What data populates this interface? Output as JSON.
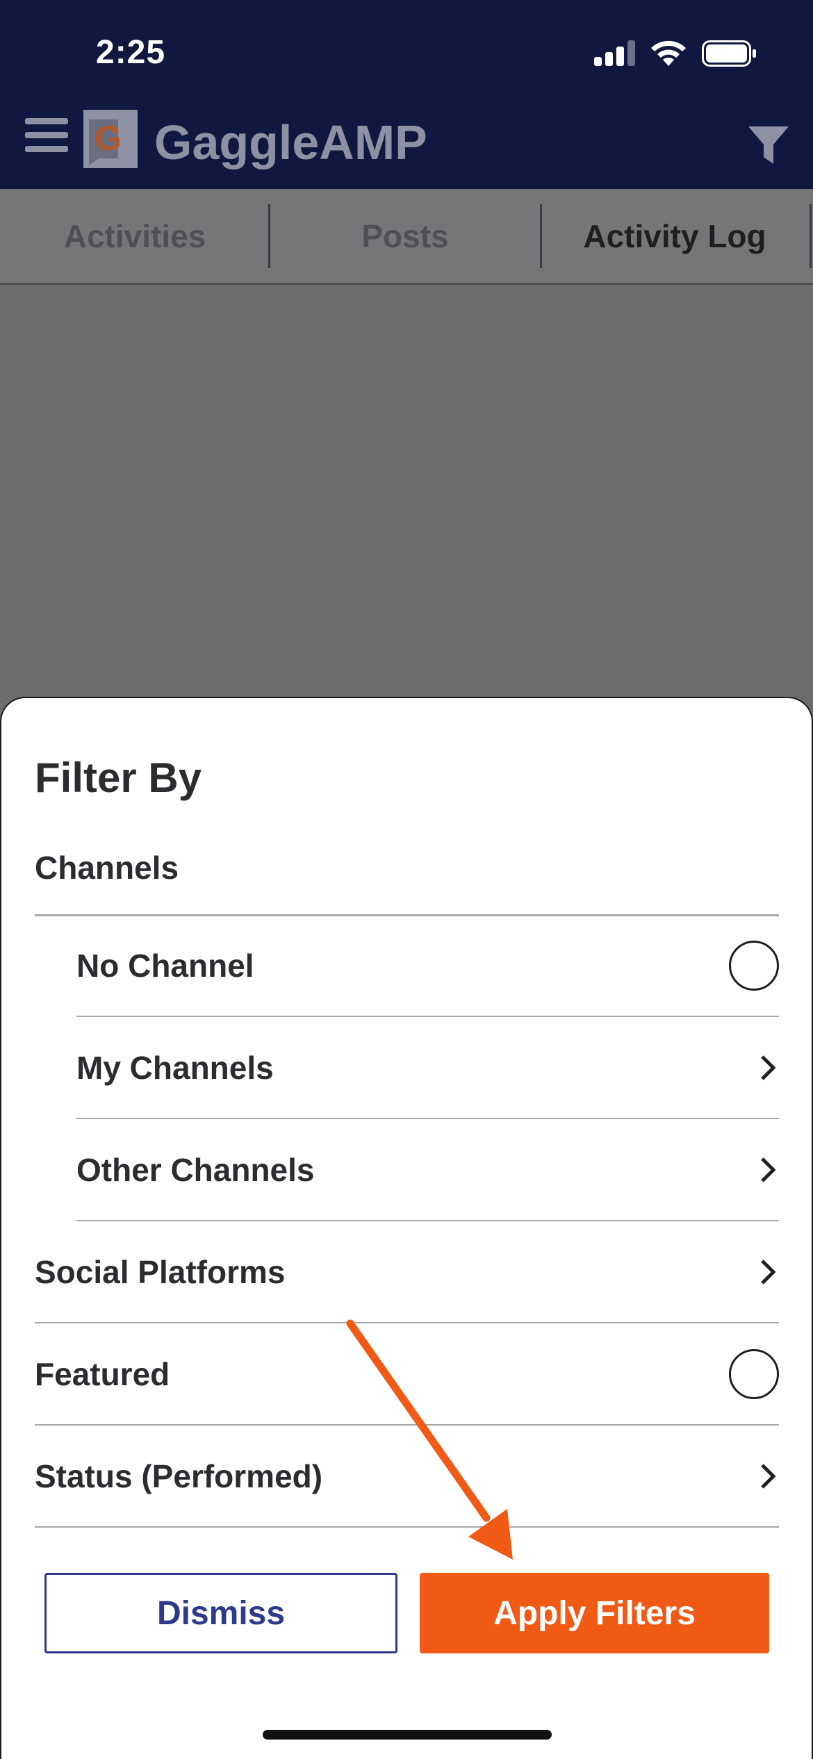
{
  "status_bar": {
    "time": "2:25"
  },
  "header": {
    "brand": "GaggleAMP",
    "logo_letter": "G"
  },
  "tabs": [
    {
      "label": "Activities",
      "active": false
    },
    {
      "label": "Posts",
      "active": false
    },
    {
      "label": "Activity Log",
      "active": true
    }
  ],
  "filter_sheet": {
    "title": "Filter By",
    "channels_label": "Channels",
    "channel_items": [
      {
        "label": "No Channel",
        "control": "radio"
      },
      {
        "label": "My Channels",
        "control": "chevron"
      },
      {
        "label": "Other Channels",
        "control": "chevron"
      }
    ],
    "top_items": [
      {
        "label": "Social Platforms",
        "control": "chevron"
      },
      {
        "label": "Featured",
        "control": "radio"
      },
      {
        "label": "Status (Performed)",
        "control": "chevron"
      }
    ],
    "dismiss_label": "Dismiss",
    "apply_label": "Apply Filters"
  },
  "colors": {
    "header_bg": "#11183f",
    "accent_orange": "#f05a14",
    "dismiss_blue": "#2d3a8c",
    "overlay": "#6c6c6e"
  },
  "icons": {
    "menu": "hamburger-icon",
    "filter": "funnel-icon",
    "chevron": "chevron-right-icon",
    "annotation": "arrow-annotation"
  }
}
